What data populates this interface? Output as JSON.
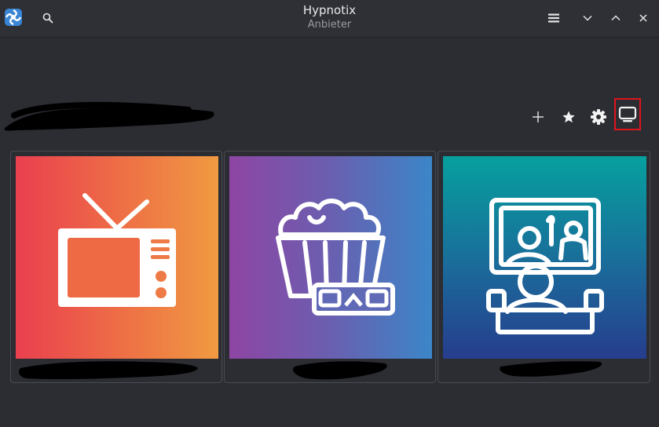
{
  "window": {
    "title": "Hypnotix",
    "subtitle": "Anbieter"
  },
  "titlebar": {
    "app_icon": "hypnotix-app-icon",
    "search_icon": "search-icon",
    "menu_icon": "hamburger-menu-icon",
    "minimize_icon": "chevron-down-icon",
    "maximize_icon": "chevron-up-icon",
    "close_icon": "close-icon"
  },
  "toolbar": {
    "heading": "",
    "buttons": [
      {
        "icon": "plus-icon"
      },
      {
        "icon": "star-icon"
      },
      {
        "icon": "gear-icon"
      },
      {
        "icon": "monitor-icon",
        "highlighted": true
      }
    ]
  },
  "cards": [
    {
      "icon": "television-icon",
      "label": "",
      "gradient": [
        "#ea3f4f",
        "#f09a42"
      ]
    },
    {
      "icon": "popcorn-3d-glasses-icon",
      "label": "",
      "gradient": [
        "#8e45a3",
        "#3b86c8"
      ]
    },
    {
      "icon": "cinema-viewer-icon",
      "label": "",
      "gradient": [
        "#06a09e",
        "#263d8d"
      ]
    }
  ],
  "colors": {
    "background": "#2b2d33",
    "highlight_border": "#e0141c",
    "redaction": "#000000"
  }
}
